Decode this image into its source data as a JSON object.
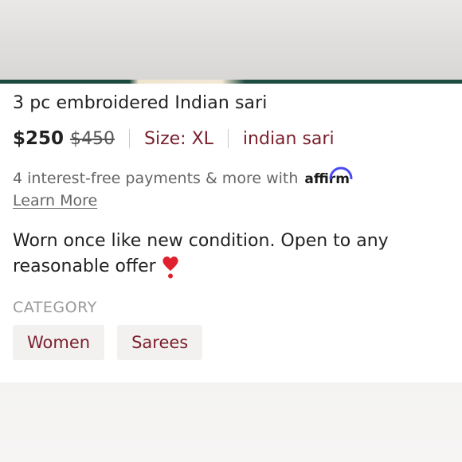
{
  "listing": {
    "title": "3 pc embroidered Indian sari",
    "price": "$250",
    "original_price": "$450",
    "size": "Size: XL",
    "brand": "indian sari"
  },
  "financing": {
    "text": "4 interest-free payments & more with",
    "provider": "affirm",
    "link_label": "Learn More"
  },
  "description": {
    "text": "Worn once like new condition. Open to any reasonable offer",
    "emoji_icon": "heart-exclamation-icon"
  },
  "category": {
    "heading": "CATEGORY",
    "chips": [
      "Women",
      "Sarees"
    ]
  },
  "colors": {
    "accent": "#7a1f2c",
    "affirm_blue": "#4a4af4",
    "heart_red": "#e0202f"
  }
}
